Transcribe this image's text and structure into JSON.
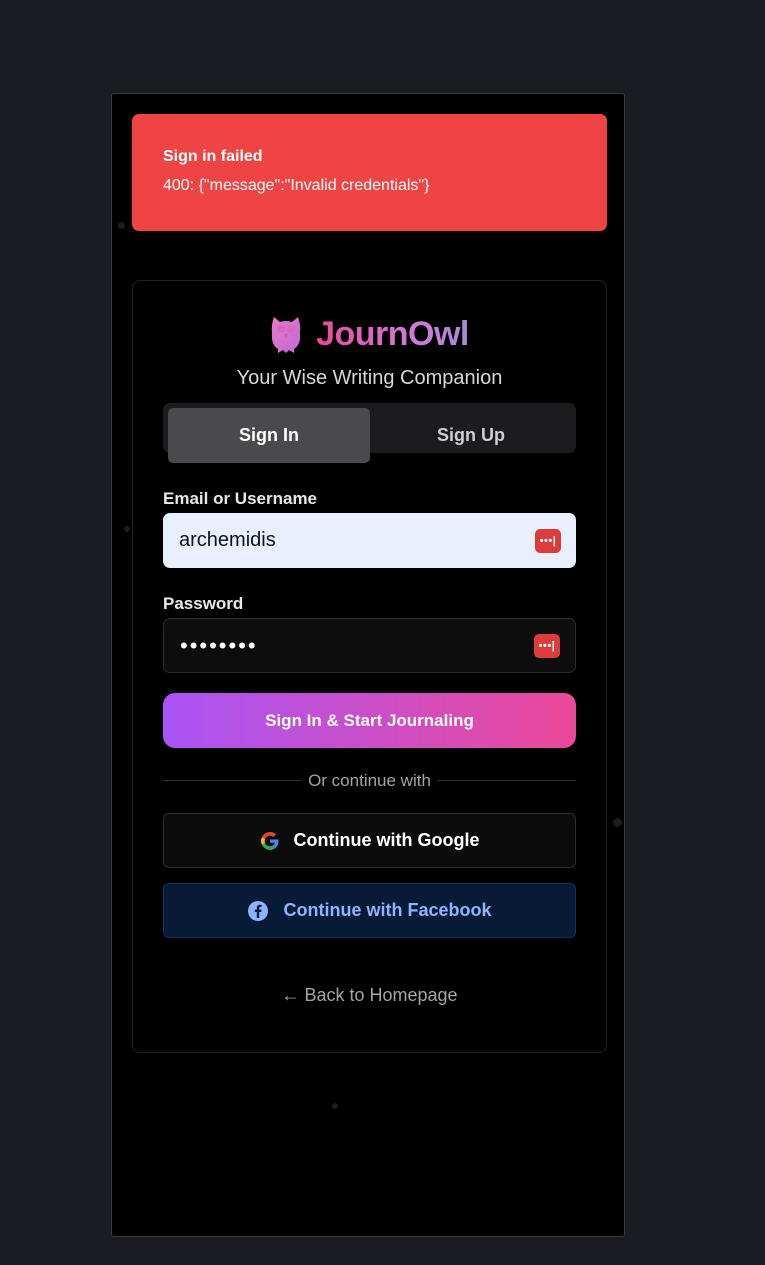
{
  "toast": {
    "title": "Sign in failed",
    "message": "400: {\"message\":\"Invalid credentials\"}",
    "color": "#ef4444"
  },
  "brand": {
    "name": "JournOwl",
    "tagline": "Your Wise Writing Companion",
    "logo_icon": "owl-icon"
  },
  "tabs": [
    {
      "label": "Sign In",
      "active": true
    },
    {
      "label": "Sign Up",
      "active": false
    }
  ],
  "form": {
    "email_label": "Email or Username",
    "email_value": "archemidis",
    "password_label": "Password",
    "password_value": "••••••••",
    "password_manager_glyph": "•••|"
  },
  "buttons": {
    "primary": "Sign In & Start Journaling",
    "divider_text": "Or continue with",
    "google": "Continue with Google",
    "facebook": "Continue with Facebook",
    "back": "← Back to Homepage"
  },
  "colors": {
    "primary_gradient_start": "#a855f7",
    "primary_gradient_end": "#ec4899",
    "facebook_text": "#8fb4ff"
  }
}
